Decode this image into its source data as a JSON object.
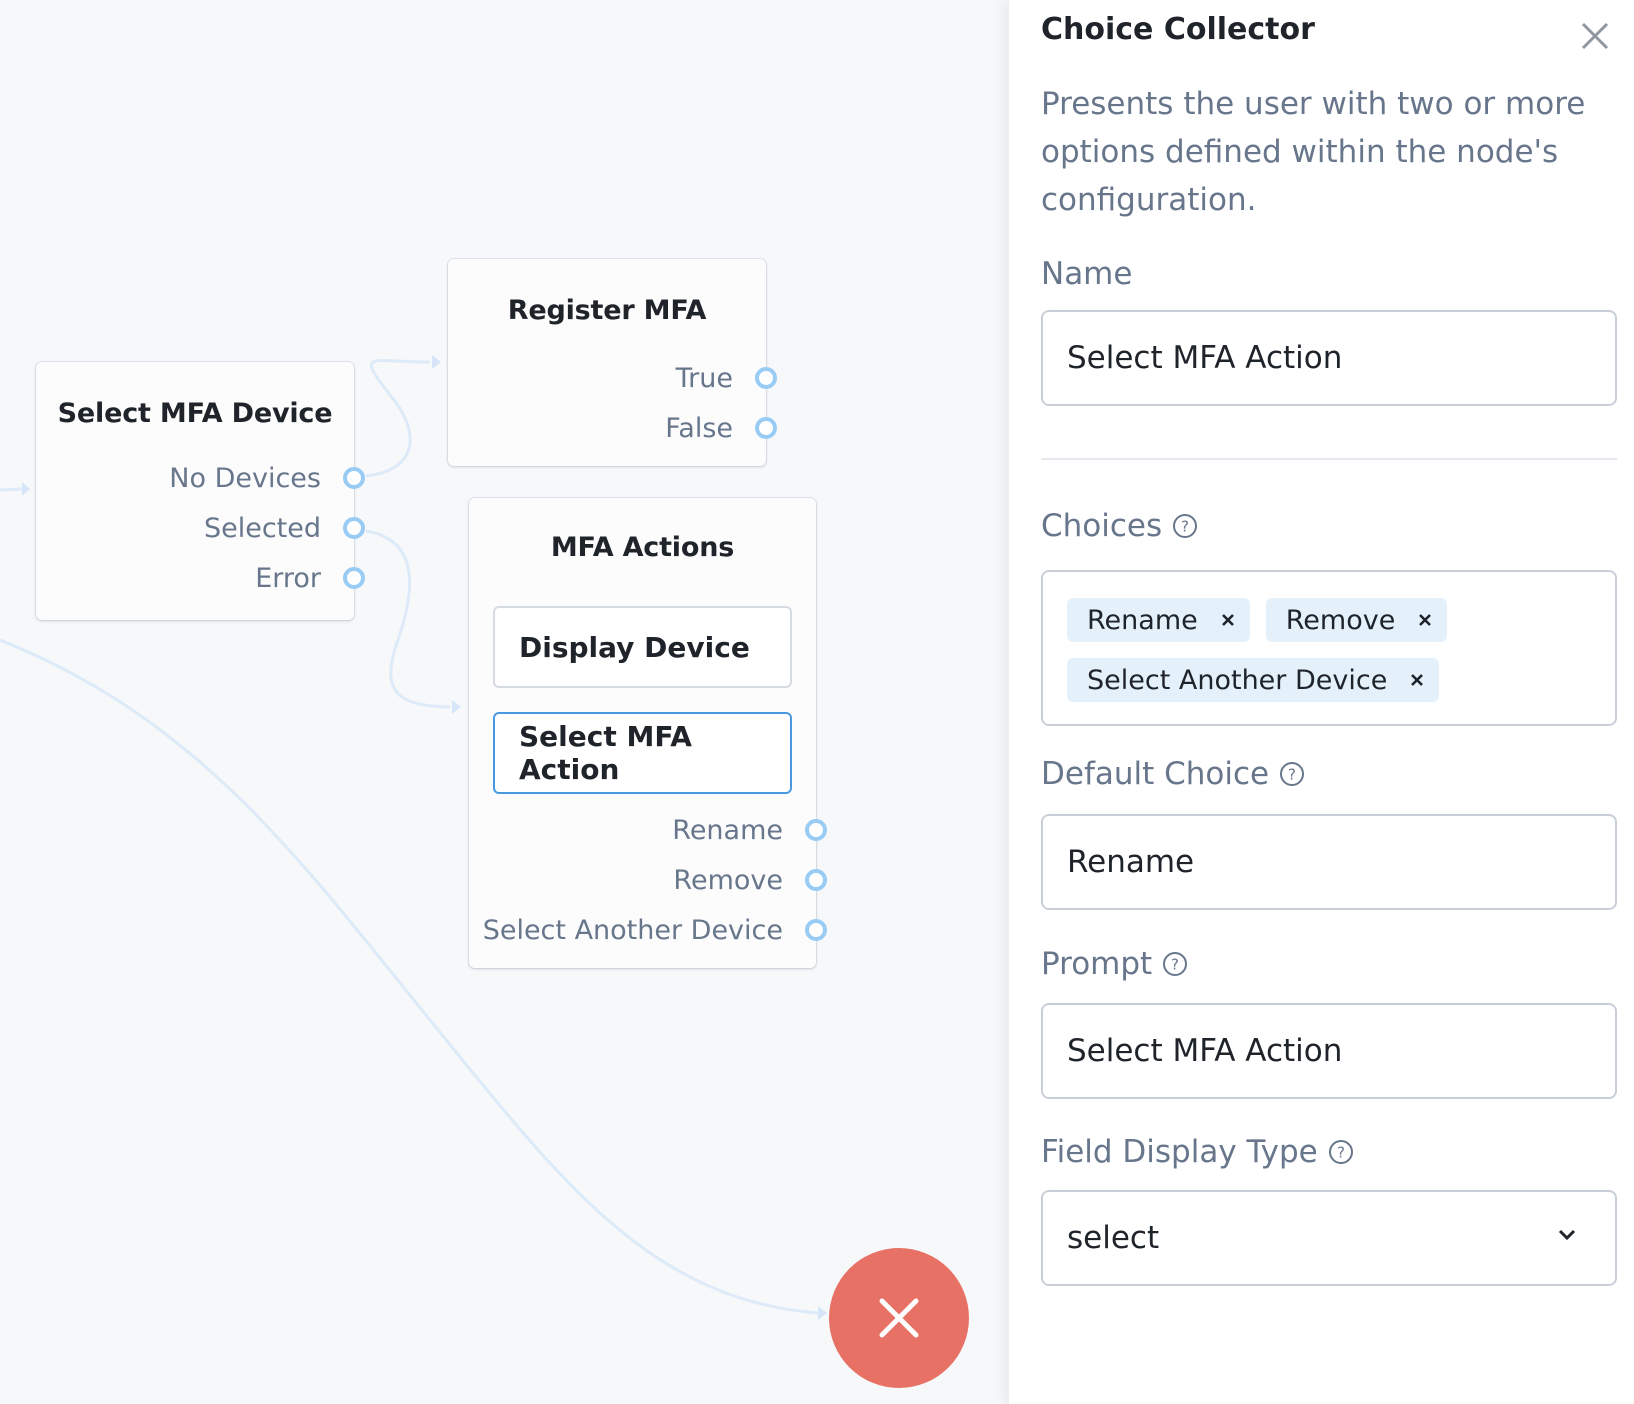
{
  "canvas": {
    "nodes": [
      {
        "title": "Select MFA Device",
        "outcomes": [
          "No Devices",
          "Selected",
          "Error"
        ]
      },
      {
        "title": "Register MFA",
        "outcomes": [
          "True",
          "False"
        ]
      },
      {
        "title": "MFA Actions",
        "steps": [
          {
            "label": "Display Device",
            "selected": false
          },
          {
            "label": "Select MFA Action",
            "selected": true
          }
        ],
        "outcomes": [
          "Rename",
          "Remove",
          "Select Another Device"
        ]
      }
    ],
    "failure_node": {
      "icon": "close-icon",
      "color": "#e77164"
    }
  },
  "panel": {
    "title": "Choice Collector",
    "close_icon": "close-icon",
    "description": "Presents the user with two or more options defined within the node's configuration.",
    "name": {
      "label": "Name",
      "value": "Select MFA Action"
    },
    "choices": {
      "label": "Choices",
      "help_icon": "question-circle-icon",
      "tags": [
        "Rename",
        "Remove",
        "Select Another Device"
      ]
    },
    "default_choice": {
      "label": "Default Choice",
      "value": "Rename"
    },
    "prompt": {
      "label": "Prompt",
      "value": "Select MFA Action"
    },
    "field_display_type": {
      "label": "Field Display Type",
      "value": "select"
    }
  },
  "colors": {
    "port": "#99ccf4",
    "selected_border": "#4a98e2",
    "tag_bg": "#e4f1fb",
    "failure": "#e77164",
    "muted_text": "#68768c"
  }
}
